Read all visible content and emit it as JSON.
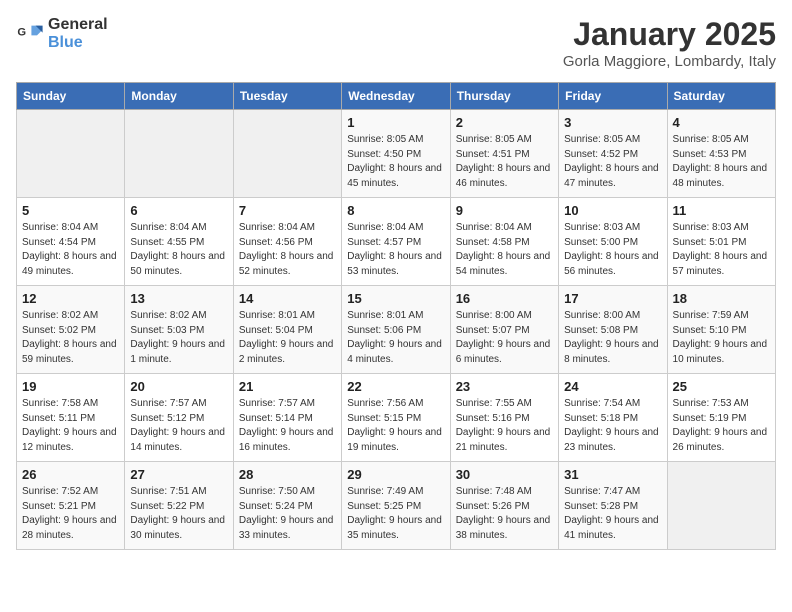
{
  "header": {
    "logo_general": "General",
    "logo_blue": "Blue",
    "title": "January 2025",
    "subtitle": "Gorla Maggiore, Lombardy, Italy"
  },
  "weekdays": [
    "Sunday",
    "Monday",
    "Tuesday",
    "Wednesday",
    "Thursday",
    "Friday",
    "Saturday"
  ],
  "weeks": [
    [
      {
        "day": "",
        "empty": true
      },
      {
        "day": "",
        "empty": true
      },
      {
        "day": "",
        "empty": true
      },
      {
        "day": "1",
        "sunrise": "8:05 AM",
        "sunset": "4:50 PM",
        "daylight": "8 hours and 45 minutes."
      },
      {
        "day": "2",
        "sunrise": "8:05 AM",
        "sunset": "4:51 PM",
        "daylight": "8 hours and 46 minutes."
      },
      {
        "day": "3",
        "sunrise": "8:05 AM",
        "sunset": "4:52 PM",
        "daylight": "8 hours and 47 minutes."
      },
      {
        "day": "4",
        "sunrise": "8:05 AM",
        "sunset": "4:53 PM",
        "daylight": "8 hours and 48 minutes."
      }
    ],
    [
      {
        "day": "5",
        "sunrise": "8:04 AM",
        "sunset": "4:54 PM",
        "daylight": "8 hours and 49 minutes."
      },
      {
        "day": "6",
        "sunrise": "8:04 AM",
        "sunset": "4:55 PM",
        "daylight": "8 hours and 50 minutes."
      },
      {
        "day": "7",
        "sunrise": "8:04 AM",
        "sunset": "4:56 PM",
        "daylight": "8 hours and 52 minutes."
      },
      {
        "day": "8",
        "sunrise": "8:04 AM",
        "sunset": "4:57 PM",
        "daylight": "8 hours and 53 minutes."
      },
      {
        "day": "9",
        "sunrise": "8:04 AM",
        "sunset": "4:58 PM",
        "daylight": "8 hours and 54 minutes."
      },
      {
        "day": "10",
        "sunrise": "8:03 AM",
        "sunset": "5:00 PM",
        "daylight": "8 hours and 56 minutes."
      },
      {
        "day": "11",
        "sunrise": "8:03 AM",
        "sunset": "5:01 PM",
        "daylight": "8 hours and 57 minutes."
      }
    ],
    [
      {
        "day": "12",
        "sunrise": "8:02 AM",
        "sunset": "5:02 PM",
        "daylight": "8 hours and 59 minutes."
      },
      {
        "day": "13",
        "sunrise": "8:02 AM",
        "sunset": "5:03 PM",
        "daylight": "9 hours and 1 minute."
      },
      {
        "day": "14",
        "sunrise": "8:01 AM",
        "sunset": "5:04 PM",
        "daylight": "9 hours and 2 minutes."
      },
      {
        "day": "15",
        "sunrise": "8:01 AM",
        "sunset": "5:06 PM",
        "daylight": "9 hours and 4 minutes."
      },
      {
        "day": "16",
        "sunrise": "8:00 AM",
        "sunset": "5:07 PM",
        "daylight": "9 hours and 6 minutes."
      },
      {
        "day": "17",
        "sunrise": "8:00 AM",
        "sunset": "5:08 PM",
        "daylight": "9 hours and 8 minutes."
      },
      {
        "day": "18",
        "sunrise": "7:59 AM",
        "sunset": "5:10 PM",
        "daylight": "9 hours and 10 minutes."
      }
    ],
    [
      {
        "day": "19",
        "sunrise": "7:58 AM",
        "sunset": "5:11 PM",
        "daylight": "9 hours and 12 minutes."
      },
      {
        "day": "20",
        "sunrise": "7:57 AM",
        "sunset": "5:12 PM",
        "daylight": "9 hours and 14 minutes."
      },
      {
        "day": "21",
        "sunrise": "7:57 AM",
        "sunset": "5:14 PM",
        "daylight": "9 hours and 16 minutes."
      },
      {
        "day": "22",
        "sunrise": "7:56 AM",
        "sunset": "5:15 PM",
        "daylight": "9 hours and 19 minutes."
      },
      {
        "day": "23",
        "sunrise": "7:55 AM",
        "sunset": "5:16 PM",
        "daylight": "9 hours and 21 minutes."
      },
      {
        "day": "24",
        "sunrise": "7:54 AM",
        "sunset": "5:18 PM",
        "daylight": "9 hours and 23 minutes."
      },
      {
        "day": "25",
        "sunrise": "7:53 AM",
        "sunset": "5:19 PM",
        "daylight": "9 hours and 26 minutes."
      }
    ],
    [
      {
        "day": "26",
        "sunrise": "7:52 AM",
        "sunset": "5:21 PM",
        "daylight": "9 hours and 28 minutes."
      },
      {
        "day": "27",
        "sunrise": "7:51 AM",
        "sunset": "5:22 PM",
        "daylight": "9 hours and 30 minutes."
      },
      {
        "day": "28",
        "sunrise": "7:50 AM",
        "sunset": "5:24 PM",
        "daylight": "9 hours and 33 minutes."
      },
      {
        "day": "29",
        "sunrise": "7:49 AM",
        "sunset": "5:25 PM",
        "daylight": "9 hours and 35 minutes."
      },
      {
        "day": "30",
        "sunrise": "7:48 AM",
        "sunset": "5:26 PM",
        "daylight": "9 hours and 38 minutes."
      },
      {
        "day": "31",
        "sunrise": "7:47 AM",
        "sunset": "5:28 PM",
        "daylight": "9 hours and 41 minutes."
      },
      {
        "day": "",
        "empty": true
      }
    ]
  ]
}
